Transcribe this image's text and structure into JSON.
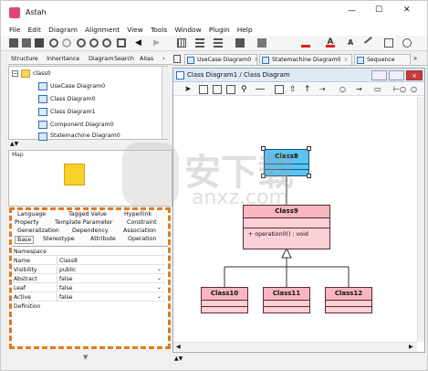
{
  "app": {
    "title": "Astah"
  },
  "window_controls": {
    "minimize": "—",
    "maximize": "☐",
    "close": "✕"
  },
  "menu": [
    "File",
    "Edit",
    "Diagram",
    "Alignment",
    "View",
    "Tools",
    "Window",
    "Plugin",
    "Help"
  ],
  "left_tabs": [
    "Structure",
    "Inheritance",
    "Diagram",
    "Search",
    "Alias"
  ],
  "tree": {
    "root": "class0",
    "items": [
      "UseCase Diagram0",
      "Class Diagram0",
      "Class Diagram1",
      "Component Diagram0",
      "Statemachine Diagram0"
    ]
  },
  "map_label": "Map",
  "property_tabs": {
    "row1": [
      "Language",
      "Tagged Value",
      "Hyperlink"
    ],
    "row2": [
      "Property",
      "Template Parameter",
      "Constraint"
    ],
    "row3": [
      "Generalization",
      "Dependency",
      "Association"
    ],
    "row4": [
      "Base",
      "Stereotype",
      "Attribute",
      "Operation"
    ]
  },
  "properties": [
    {
      "label": "Namespace",
      "value": ""
    },
    {
      "label": "Name",
      "value": "Class8"
    },
    {
      "label": "Visibility",
      "value": "public"
    },
    {
      "label": "Abstract",
      "value": "false"
    },
    {
      "label": "Leaf",
      "value": "false"
    },
    {
      "label": "Active",
      "value": "false"
    },
    {
      "label": "Definition",
      "value": ""
    }
  ],
  "editor_tabs": [
    "UseCase Diagram0",
    "Statemachine Diagram0",
    "Sequence"
  ],
  "diagram_title": "Class Diagram1 / Class Diagram",
  "classes": {
    "class8": "Class8",
    "class9": "Class9",
    "class9_op": "+ operation0() : void",
    "class10": "Class10",
    "class11": "Class11",
    "class12": "Class12"
  },
  "colors": {
    "selected_fill": "#5bc4f2",
    "class_fill": "#fbd0d6",
    "class_header": "#f7b6c0",
    "highlight": "#e07a22"
  },
  "watermark": {
    "cn": "安下载",
    "en": "anxz.com"
  }
}
